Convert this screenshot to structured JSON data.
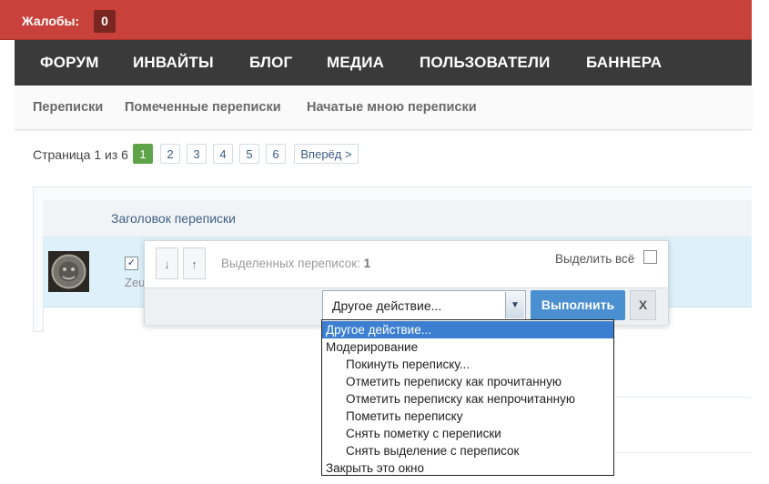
{
  "topbar": {
    "complaints_label": "Жалобы:",
    "complaints_count": "0"
  },
  "navbar": {
    "items": [
      "ФОРУМ",
      "ИНВАЙТЫ",
      "БЛОГ",
      "МЕДИА",
      "ПОЛЬЗОВАТЕЛИ",
      "БАННЕРА"
    ]
  },
  "subnav": {
    "items": [
      "Переписки",
      "Помеченные переписки",
      "Начатые мною переписки"
    ]
  },
  "pagination": {
    "label": "Страница 1 из 6",
    "pages": [
      "1",
      "2",
      "3",
      "4",
      "5",
      "6"
    ],
    "current": "1",
    "next_label": "Вперёд >"
  },
  "list": {
    "header_title": "Заголовок переписки",
    "row": {
      "checked_mark": "✓",
      "author": "Zeu"
    }
  },
  "popup": {
    "down_arrow": "↓",
    "up_arrow": "↑",
    "selected_prefix": "Выделенных переписок:",
    "selected_count": "1",
    "select_all_label": "Выделить всё",
    "action_value": "Другое действие...",
    "select_arrow": "▼",
    "execute_label": "Выполнить",
    "close_label": "X"
  },
  "dropdown": {
    "options": [
      "Другое действие...",
      "Модерирование",
      "Покинуть переписку...",
      "Отметить переписку как прочитанную",
      "Отметить переписку как непрочитанную",
      "Пометить переписку",
      "Снять пометку с переписки",
      "Снять выделение с переписок",
      "Закрыть это окно"
    ],
    "selected_index": 0
  },
  "colors": {
    "topbar": "#c8413b",
    "navbar": "#3a3a3a",
    "active_page": "#5ea347",
    "execute_button": "#4a8fd0",
    "row_highlight": "#def1fa",
    "dropdown_selected": "#3c7fd0"
  }
}
